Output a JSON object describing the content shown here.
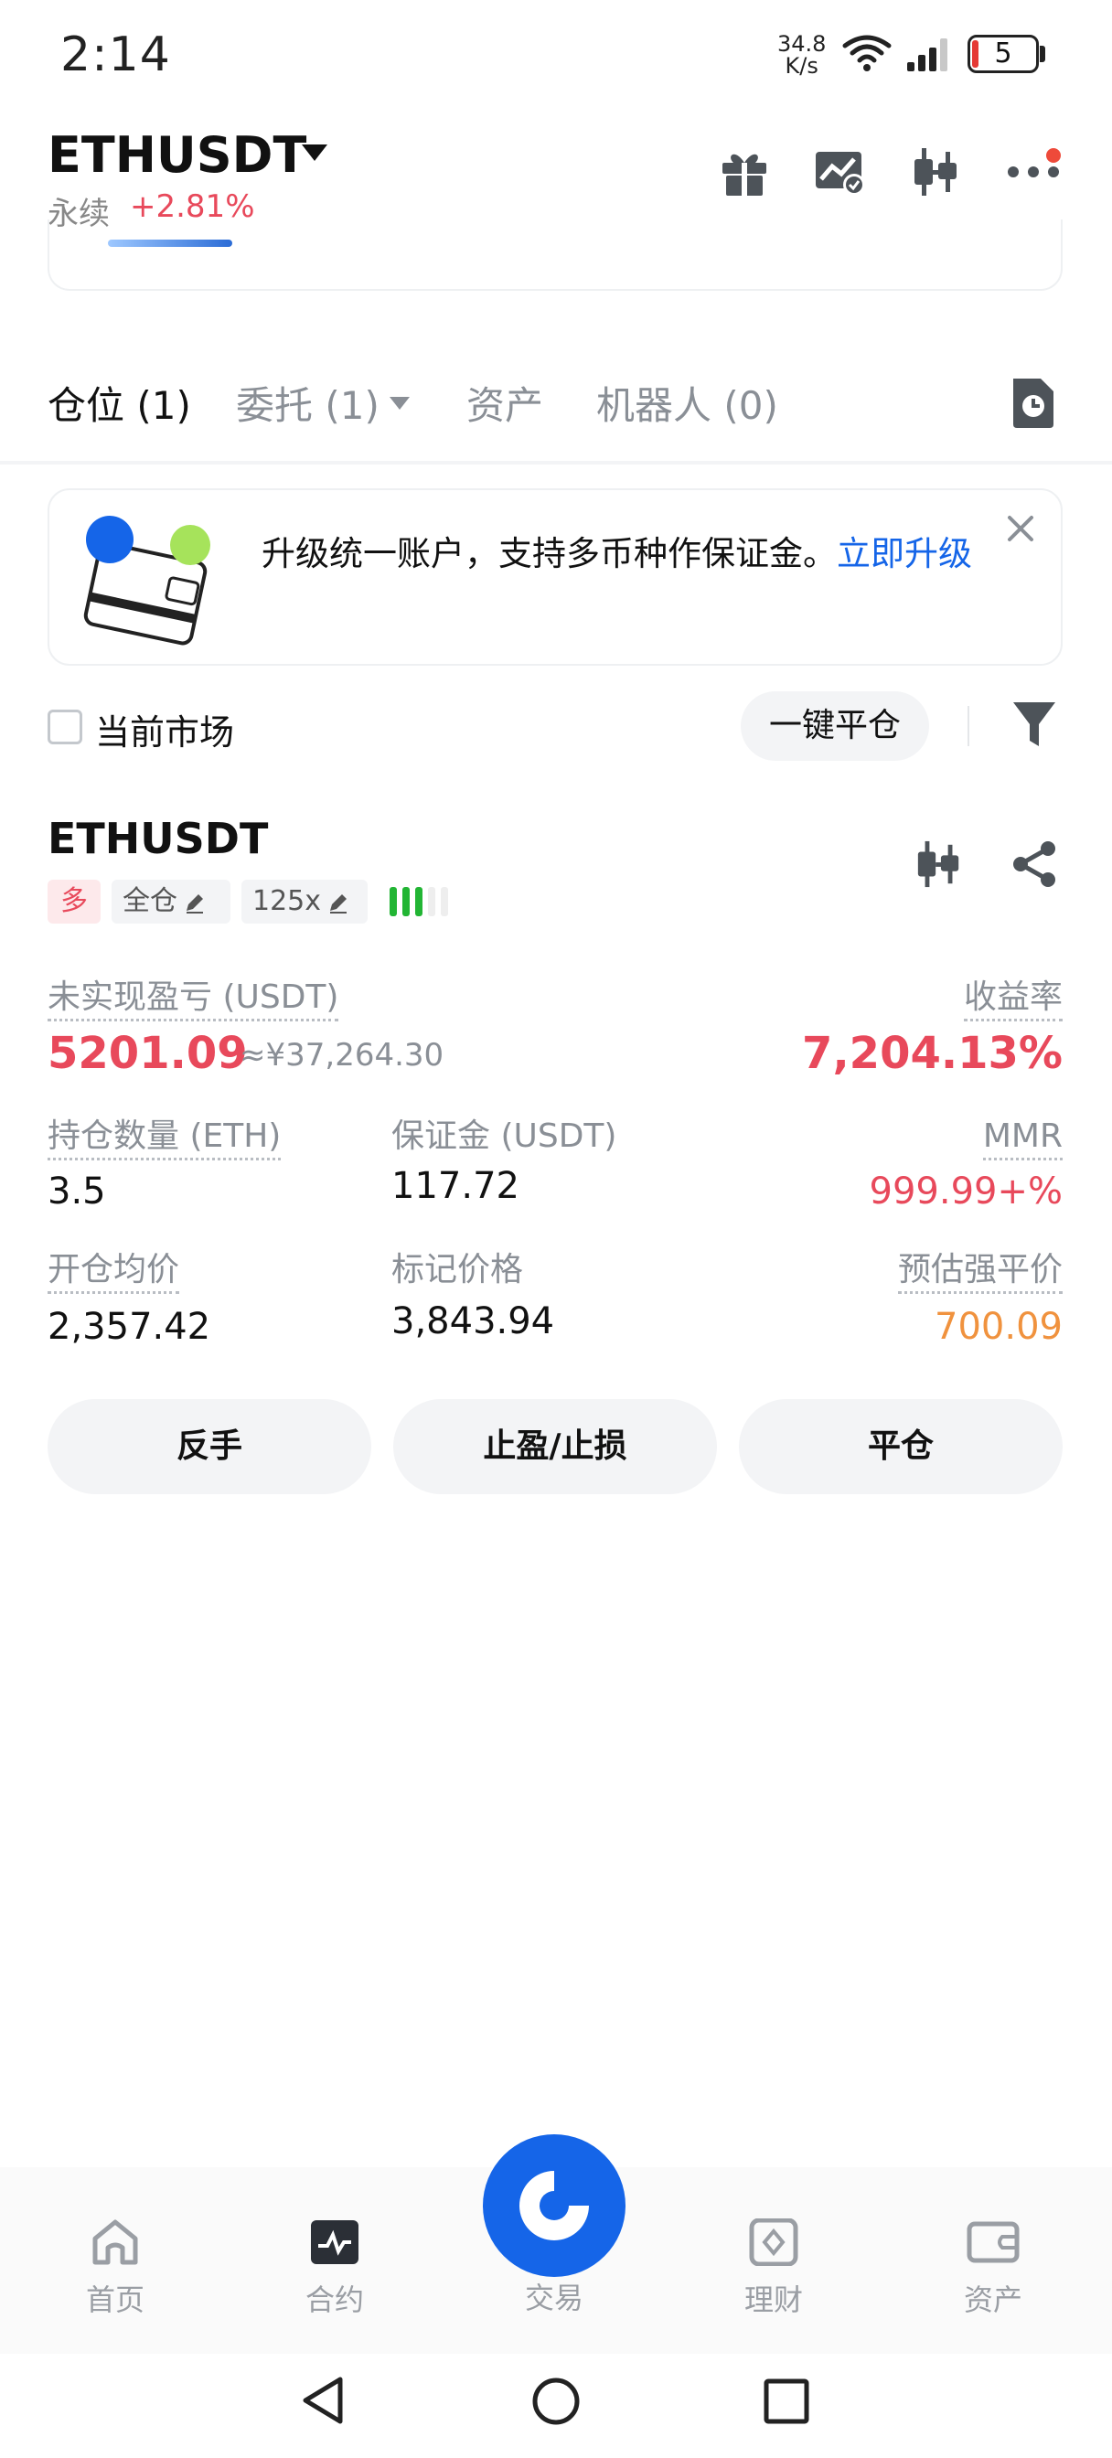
{
  "status_bar": {
    "time": "2:14",
    "net_speed_value": "34.8",
    "net_speed_unit": "K/s",
    "battery_level": "5"
  },
  "header": {
    "symbol": "ETHUSDT",
    "contract_type": "永续",
    "change": "+2.81%",
    "icons": [
      "gift-icon",
      "chart-check-icon",
      "candlestick-icon",
      "more-icon"
    ]
  },
  "tabs": [
    {
      "label": "仓位 (1)",
      "active": true
    },
    {
      "label": "委托 (1)",
      "has_dropdown": true
    },
    {
      "label": "资产"
    },
    {
      "label": "机器人 (0)"
    }
  ],
  "banner": {
    "text": "升级统一账户，支持多币种作保证金。",
    "link": "立即升级"
  },
  "filter": {
    "current_market": "当前市场",
    "close_all": "一键平仓"
  },
  "position": {
    "symbol": "ETHUSDT",
    "side": "多",
    "margin_mode": "全仓",
    "leverage": "125x",
    "risk_level": 3,
    "risk_level_max": 5,
    "unrealized_pnl_label": "未实现盈亏 (USDT)",
    "unrealized_pnl": "5201.09",
    "unrealized_pnl_cny": "≈¥37,264.30",
    "roe_label": "收益率",
    "roe": "7,204.13%",
    "qty_label": "持仓数量 (ETH)",
    "qty": "3.5",
    "margin_label": "保证金 (USDT)",
    "margin": "117.72",
    "mmr_label": "MMR",
    "mmr": "999.99+%",
    "entry_label": "开仓均价",
    "entry_price": "2,357.42",
    "mark_label": "标记价格",
    "mark_price": "3,843.94",
    "liq_label": "预估强平价",
    "liq_price": "700.09",
    "actions": [
      "反手",
      "止盈/止损",
      "平仓"
    ]
  },
  "bottom_nav": [
    {
      "label": "首页",
      "icon": "home-icon"
    },
    {
      "label": "合约",
      "icon": "futures-icon",
      "active": true
    },
    {
      "label": "交易",
      "icon": "trade-icon"
    },
    {
      "label": "理财",
      "icon": "earn-icon"
    },
    {
      "label": "资产",
      "icon": "wallet-icon"
    }
  ],
  "colors": {
    "accent": "#1565e8",
    "up": "#e8495b",
    "warning": "#f0923e",
    "risk_bar": "#22b534"
  }
}
